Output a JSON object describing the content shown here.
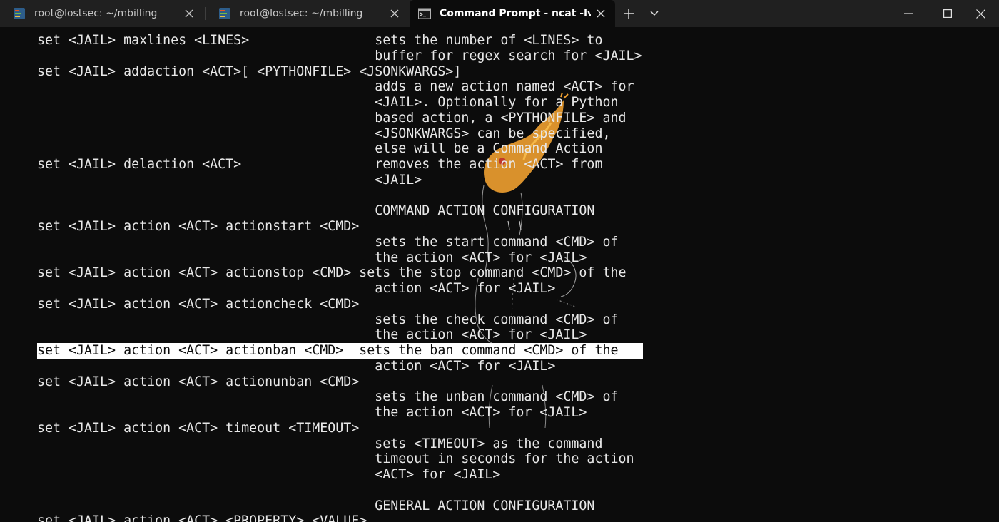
{
  "tabs": [
    {
      "title": "root@lostsec: ~/mbilling",
      "icon": "ubuntu-terminal-icon",
      "active": false
    },
    {
      "title": "root@lostsec: ~/mbilling",
      "icon": "ubuntu-terminal-icon",
      "active": false
    },
    {
      "title": "Command Prompt - ncat  -lvn",
      "icon": "cmd-prompt-icon",
      "active": true
    }
  ],
  "titlebar": {
    "new_tab": "+",
    "dropdown": "chevron-down-icon",
    "minimize": "minimize-icon",
    "maximize": "maximize-icon",
    "close": "close-icon"
  },
  "terminal": {
    "lines": [
      "set <JAIL> maxlines <LINES>                sets the number of <LINES> to",
      "                                           buffer for regex search for <JAIL>",
      "set <JAIL> addaction <ACT>[ <PYTHONFILE> <JSONKWARGS>]",
      "                                           adds a new action named <ACT> for",
      "                                           <JAIL>. Optionally for a Python",
      "                                           based action, a <PYTHONFILE> and",
      "                                           <JSONKWARGS> can be specified,",
      "                                           else will be a Command Action",
      "set <JAIL> delaction <ACT>                 removes the action <ACT> from",
      "                                           <JAIL>",
      "",
      "                                           COMMAND ACTION CONFIGURATION",
      "set <JAIL> action <ACT> actionstart <CMD>",
      "                                           sets the start command <CMD> of",
      "                                           the action <ACT> for <JAIL>",
      "set <JAIL> action <ACT> actionstop <CMD> sets the stop command <CMD> of the",
      "                                           action <ACT> for <JAIL>",
      "set <JAIL> action <ACT> actioncheck <CMD>",
      "                                           sets the check command <CMD> of",
      "                                           the action <ACT> for <JAIL>",
      "set <JAIL> action <ACT> actionban <CMD>  sets the ban command <CMD> of the",
      "                                           action <ACT> for <JAIL>",
      "set <JAIL> action <ACT> actionunban <CMD>",
      "                                           sets the unban command <CMD> of",
      "                                           the action <ACT> for <JAIL>",
      "set <JAIL> action <ACT> timeout <TIMEOUT>",
      "                                           sets <TIMEOUT> as the command",
      "                                           timeout in seconds for the action",
      "                                           <ACT> for <JAIL>",
      "",
      "                                           GENERAL ACTION CONFIGURATION",
      "set <JAIL> action <ACT> <PROPERTY> <VALUE>"
    ],
    "highlight_line": 20
  },
  "colors": {
    "background": "#0c0c0c",
    "text": "#e8e8e8",
    "tabbar": "#202020",
    "accent_fire": "#f0a030"
  }
}
